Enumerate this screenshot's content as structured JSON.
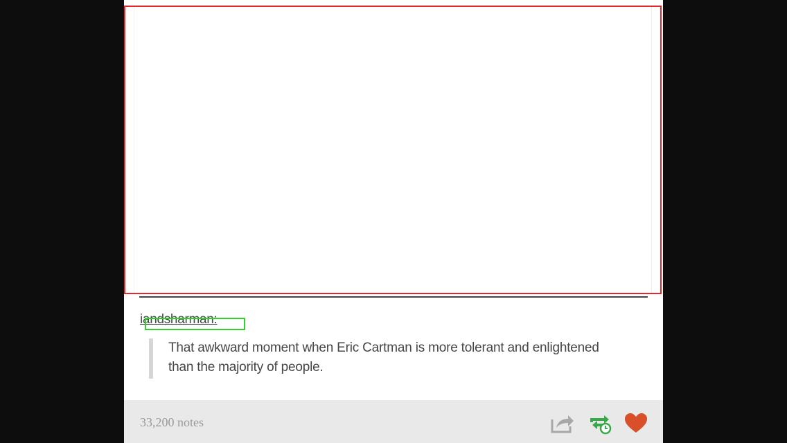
{
  "post": {
    "username": "iandsharman",
    "username_suffix": ":",
    "quote": "That awkward moment when Eric Cartman is more tolerant and enlightened than the majority of people.",
    "notes_label": "33,200 notes"
  },
  "icons": {
    "share": "share-icon",
    "reblog": "reblog-queue-icon",
    "like": "heart-icon"
  },
  "colors": {
    "like": "#d94f2a",
    "reblog": "#3aa84a",
    "media_outline": "#e02a2a",
    "highlight_outline": "#2fd12f"
  }
}
